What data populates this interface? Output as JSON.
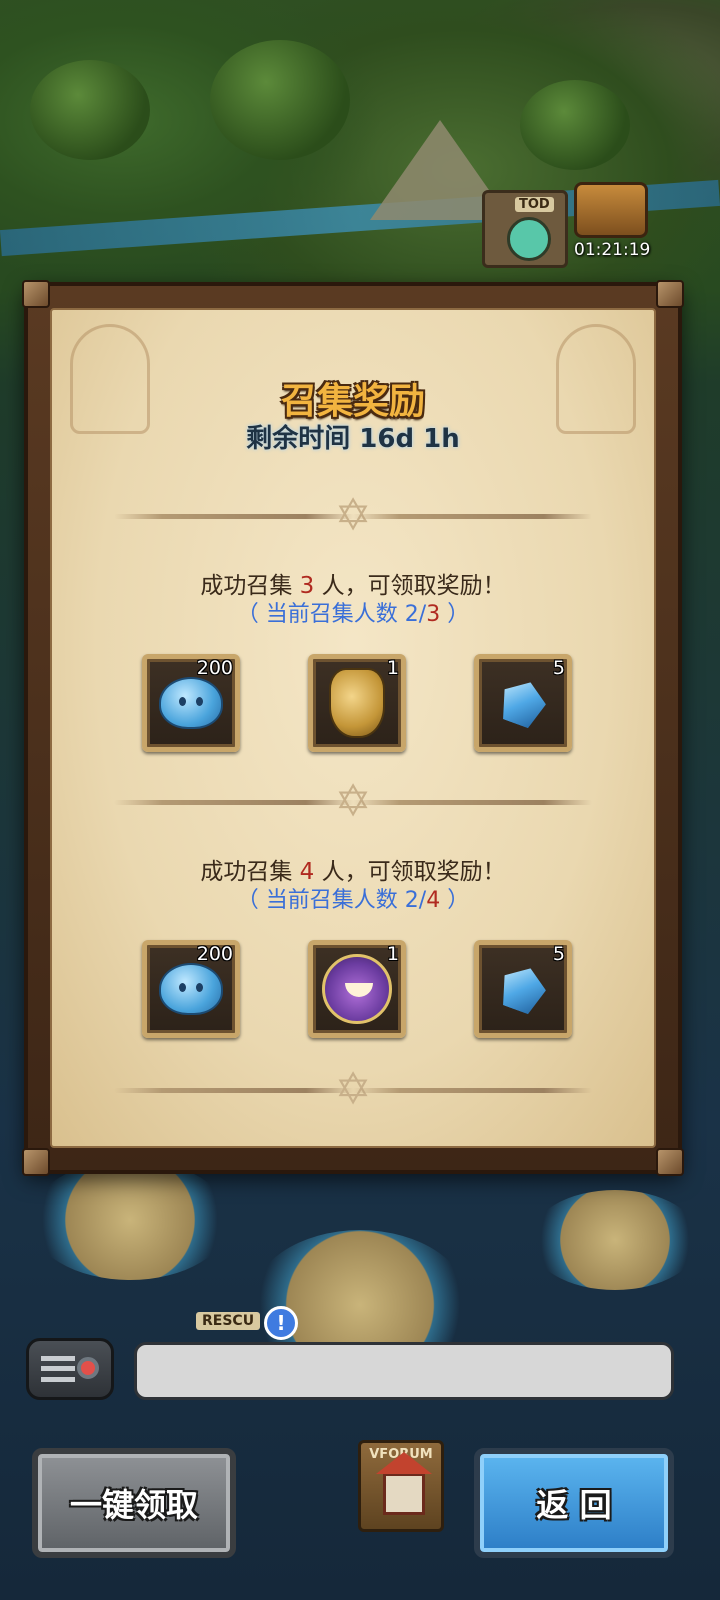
{
  "map": {
    "top_task_tag": "TOD",
    "event_timer": "01:21:19",
    "rescue_tag": "RESCU",
    "alert_mark": "!",
    "forum_label": "VFORUM"
  },
  "dialog": {
    "title": "召集奖励",
    "remaining_time": "剩余时间 16d 1h",
    "tiers": [
      {
        "req_prefix": "成功召集 ",
        "req_number": "3",
        "req_suffix": " 人，可领取奖励！",
        "cur_prefix": "（ 当前召集人数 2/",
        "cur_target": "3",
        "cur_suffix": " ）",
        "rewards": [
          {
            "icon": "blue-slime-icon",
            "count": "200"
          },
          {
            "icon": "golden-urn-icon",
            "count": "1"
          },
          {
            "icon": "blue-crystal-icon",
            "count": "5"
          }
        ]
      },
      {
        "req_prefix": "成功召集 ",
        "req_number": "4",
        "req_suffix": " 人，可领取奖励！",
        "cur_prefix": "（ 当前召集人数 2/",
        "cur_target": "4",
        "cur_suffix": " ）",
        "rewards": [
          {
            "icon": "blue-slime-icon",
            "count": "200"
          },
          {
            "icon": "hero-portrait-icon",
            "count": "1"
          },
          {
            "icon": "blue-crystal-icon",
            "count": "5"
          }
        ]
      }
    ]
  },
  "buttons": {
    "claim_all": "一键领取",
    "back": "返 回"
  },
  "colors": {
    "title": "#f2b440",
    "required_number": "#b02a20",
    "current_count": "#3a6fd8",
    "back_button": "#2c7dc6",
    "claim_button": "#5e6266"
  }
}
